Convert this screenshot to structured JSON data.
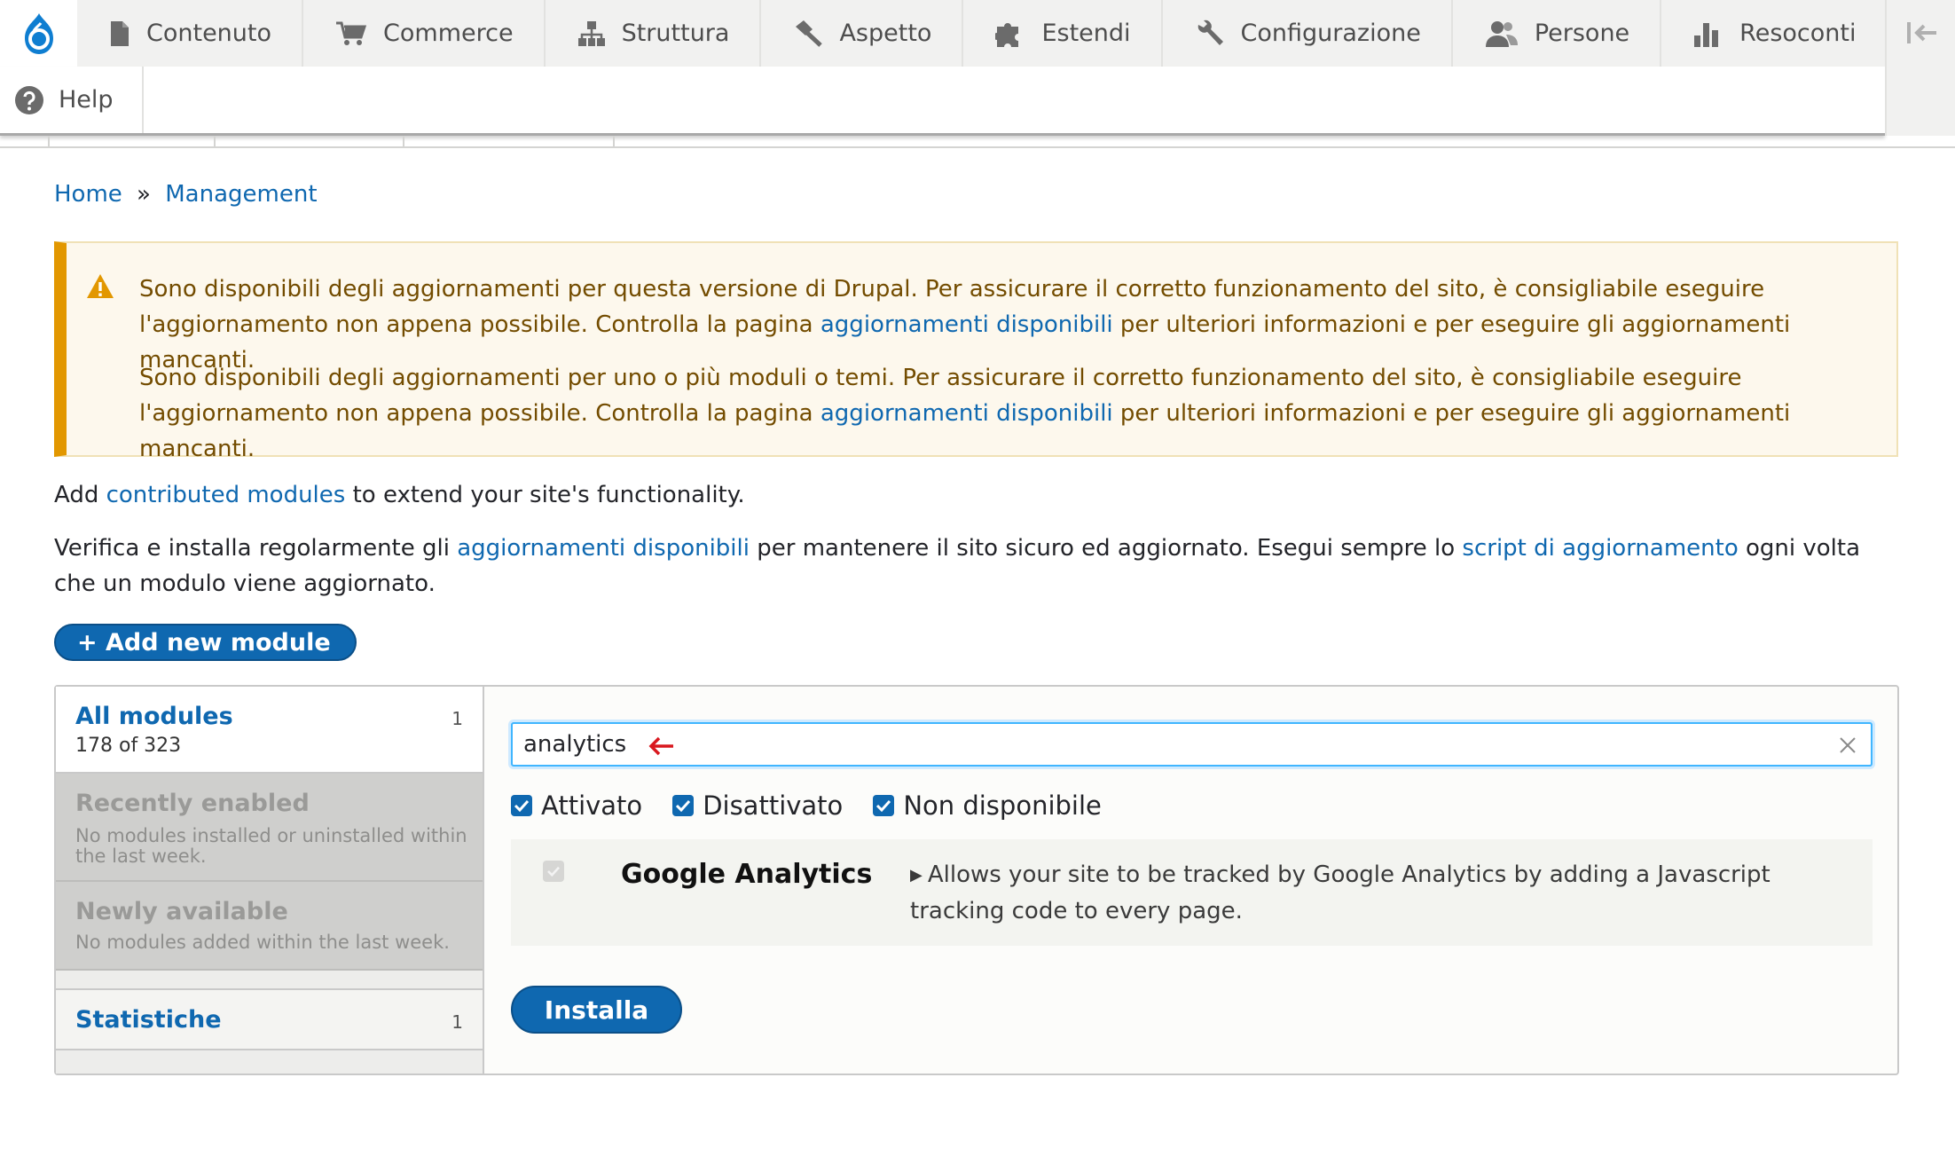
{
  "toolbar": {
    "menu": [
      {
        "label": "Contenuto",
        "icon": "file-icon"
      },
      {
        "label": "Commerce",
        "icon": "cart-icon"
      },
      {
        "label": "Struttura",
        "icon": "sitemap-icon"
      },
      {
        "label": "Aspetto",
        "icon": "paintbrush-icon"
      },
      {
        "label": "Estendi",
        "icon": "puzzle-icon"
      },
      {
        "label": "Configurazione",
        "icon": "wrench-icon"
      },
      {
        "label": "Persone",
        "icon": "people-icon"
      },
      {
        "label": "Resoconti",
        "icon": "bar-chart-icon"
      }
    ],
    "help_label": "Help"
  },
  "breadcrumb": {
    "home": "Home",
    "separator": "»",
    "current": "Management"
  },
  "warning": {
    "p1_before": "Sono disponibili degli aggiornamenti per questa versione di Drupal. Per assicurare il corretto funzionamento del sito, è consigliabile eseguire l'aggiornamento non appena possibile. Controlla la pagina ",
    "p1_link": "aggiornamenti disponibili",
    "p1_after": " per ulteriori informazioni e per eseguire gli aggiornamenti mancanti.",
    "p2_before": "Sono disponibili degli aggiornamenti per uno o più moduli o temi. Per assicurare il corretto funzionamento del sito, è consigliabile eseguire l'aggiornamento non appena possibile. Controlla la pagina ",
    "p2_link": "aggiornamenti disponibili",
    "p2_after": " per ulteriori informazioni e per eseguire gli aggiornamenti mancanti."
  },
  "intro": {
    "line1_before": "Add ",
    "line1_link": "contributed modules",
    "line1_after": " to extend your site's functionality.",
    "line2_before": "Verifica e installa regolarmente gli ",
    "line2_link1": "aggiornamenti disponibili",
    "line2_mid": " per mantenere il sito sicuro ed aggiornato. Esegui sempre lo ",
    "line2_link2": "script di aggiornamento",
    "line2_after": " ogni volta che un modulo viene aggiornato."
  },
  "add_button": "+ Add new module",
  "vertical_tabs": {
    "all": {
      "title": "All modules",
      "count": "1",
      "summary": "178 of 323"
    },
    "recent": {
      "title": "Recently enabled",
      "desc": "No modules installed or uninstalled within the last week."
    },
    "new": {
      "title": "Newly available",
      "desc": "No modules added within the last week."
    },
    "stat": {
      "title": "Statistiche",
      "count": "1"
    }
  },
  "search": {
    "value": "analytics"
  },
  "filters": {
    "enabled": "Attivato",
    "disabled": "Disattivato",
    "unavailable": "Non disponibile"
  },
  "module": {
    "name": "Google Analytics",
    "description": "Allows your site to be tracked by Google Analytics by adding a Javascript tracking code to every page."
  },
  "install_button": "Installa",
  "colors": {
    "link": "#0f68b0",
    "warning_border": "#e29700",
    "warning_text": "#734c00",
    "focus": "#40b6ff",
    "arrow": "#d9181f"
  }
}
